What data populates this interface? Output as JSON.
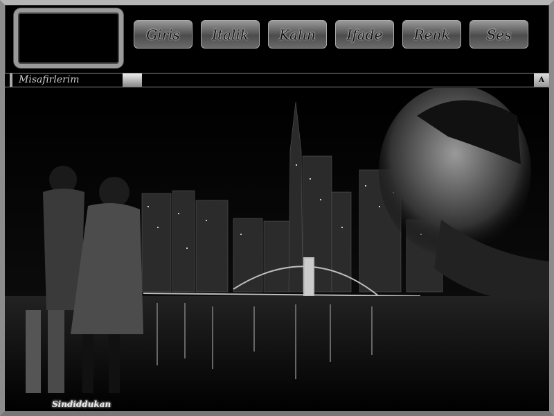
{
  "nav": {
    "items": [
      {
        "label": "Giris"
      },
      {
        "label": "Italik"
      },
      {
        "label": "Kalın"
      },
      {
        "label": "Ifade"
      },
      {
        "label": "Renk"
      },
      {
        "label": "Ses"
      }
    ]
  },
  "guest_bar": {
    "label": "Misafirlerim",
    "button": "A"
  },
  "signature": "Sindiddukan",
  "colors": {
    "background": "#000000",
    "frame": "#8c8c8c",
    "button_top": "#9a9a9a",
    "button_bottom": "#4c4c4c"
  }
}
